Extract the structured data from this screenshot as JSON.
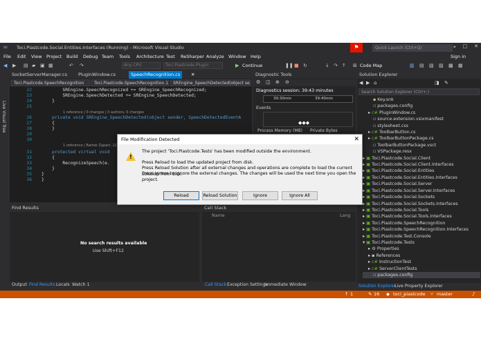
{
  "window": {
    "title": "Toci.Piastcode.Social.Entities.Interfaces (Running) - Microsoft Visual Studio",
    "quick_launch": "Quick Launch (Ctrl+Q)",
    "sign_in": "Sign in"
  },
  "menu": [
    "File",
    "Edit",
    "View",
    "Project",
    "Build",
    "Debug",
    "Team",
    "Tools",
    "Architecture",
    "Test",
    "ReSharper",
    "Analyze",
    "Window",
    "Help"
  ],
  "toolbar": {
    "combo1": "Any CPU",
    "combo2": "Toci.Piastcode.Plugin",
    "continue": "Continue",
    "code_map": "Code Map"
  },
  "side_strip": "Live Visual Tree",
  "editor": {
    "tabs": [
      "SocketServerManager.cs",
      "PluginWindow.cs",
      "SpeechRecognition.cs"
    ],
    "nav": [
      "Toci.Piastcode.SpeechRecognition",
      "Toci.Piastcode.SpeechRecognition.1",
      "SREngine_SpeechDetected(object se"
    ],
    "lines": [
      {
        "n": "22",
        "t": "        SREngine.SpeechRecognized += SREngine_SpeechRecognized;"
      },
      {
        "n": "23",
        "t": "        SREngine.SpeechDetected += SREngine_SpeechDetected;"
      },
      {
        "n": "24",
        "t": "    }"
      },
      {
        "n": "25",
        "t": ""
      },
      {
        "n": "26",
        "t": "    private void SREngine_SpeechDetected(object sender, SpeechDetectedEventA"
      },
      {
        "n": "27",
        "t": "    {"
      },
      {
        "n": "28",
        "t": "    }"
      },
      {
        "n": "29",
        "t": ""
      },
      {
        "n": "30",
        "t": ""
      },
      {
        "n": "31",
        "t": "    protected virtual void"
      },
      {
        "n": "32",
        "t": "    {"
      },
      {
        "n": "33",
        "t": "        RecognizeSpeech(e."
      },
      {
        "n": "34",
        "t": "    }"
      },
      {
        "n": "35",
        "t": "}"
      },
      {
        "n": "36",
        "t": "}"
      }
    ],
    "ref1": "1 reference | 0 changes | 0 authors, 0 changes",
    "ref2": "1 reference | Bartek Zapart, 12 hou"
  },
  "diag": {
    "title": "Diagnostic Tools",
    "session": "Diagnostics session: 39:43 minutes",
    "t1": "39:30min",
    "t2": "39:40min",
    "events": "Events",
    "memory": "Process Memory (MB)",
    "private": "Private Bytes"
  },
  "solution_explorer": {
    "title": "Solution Explorer",
    "search": "Search Solution Explorer (Ctrl+;)",
    "items": [
      "Key.snk",
      "packages.config",
      "PluginWindow.cs",
      "source.extension.vsixmanifest",
      "stylesheet.css",
      "ToolbarButton.cs",
      "ToolbarButtonPackage.cs",
      "ToolbarButtonPackage.vsct",
      "VSPackage.resx",
      "Toci.Piastcode.Social.Client",
      "Toci.Piastcode.Social.Client.Interfaces",
      "Toci.Piastcode.Social.Entities",
      "Toci.Piastcode.Social.Entities.Interfaces",
      "Toci.Piastcode.Social.Server",
      "Toci.Piastcode.Social.Server.Interfaces",
      "Toci.Piastcode.Social.Sockets",
      "Toci.Piastcode.Social.Sockets.Interfaces",
      "Toci.Piastcode.Social.Tools",
      "Toci.Piastcode.Social.Tools.Interfaces",
      "Toci.Piastcode.SpeechRecognition",
      "Toci.Piastcode.SpeechRecognition.Interfaces",
      "Toci.Piastcode.Test.Console",
      "Toci.Piastcode.Tests",
      "Properties",
      "References",
      "InstructionTest",
      "ServerClientTests",
      "packages.config"
    ],
    "tabs": [
      "Solution Explorer",
      "Live Property Explorer"
    ]
  },
  "find": {
    "title": "Find Results",
    "no_results": "No search results available",
    "hint": "Use Shift+F12",
    "tabs": [
      "Output",
      "Find Results",
      "Locals",
      "Watch 1"
    ]
  },
  "callstack": {
    "title": "Call Stack",
    "col_name": "Name",
    "col_lang": "Lang",
    "tabs": [
      "Call Stack",
      "Exception Settings",
      "Immediate Window"
    ]
  },
  "statusbar": {
    "up": "1",
    "pencil": "16",
    "repo": "toci_piastcode",
    "branch": "master"
  },
  "dialog": {
    "title": "File Modification Detected",
    "line1": "The project 'Toci.Piastcode.Tests' has been modified outside the environment.",
    "line2": "Press Reload to load the updated project from disk.",
    "line3": "Press Reload Solution after all external changes and operations are complete to load the current solution from disk.",
    "line4": "Press Ignore to ignore the external changes. The changes will be used the next time you open the project.",
    "buttons": [
      "Reload",
      "Reload Solution",
      "Ignore",
      "Ignore All"
    ]
  },
  "colors": {
    "accent": "#007acc",
    "status": "#ca5100",
    "warning": "#f2c12e"
  }
}
